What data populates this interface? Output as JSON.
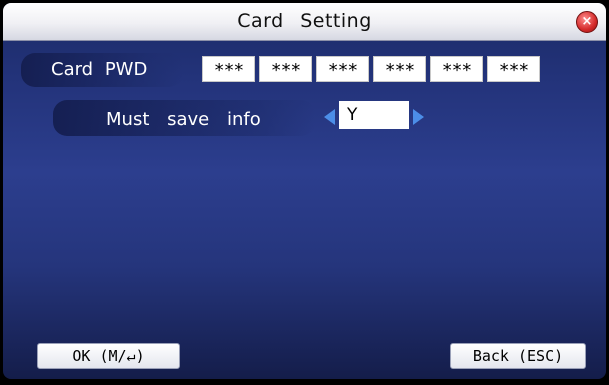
{
  "window": {
    "title": "Card  Setting",
    "close_icon": "close-icon"
  },
  "card_pwd": {
    "label": "Card PWD",
    "fields": [
      "***",
      "***",
      "***",
      "***",
      "***",
      "***"
    ]
  },
  "must_save_info": {
    "label": "Must save  info",
    "value": "Y",
    "left_arrow_icon": "arrow-left-icon",
    "right_arrow_icon": "arrow-right-icon"
  },
  "softkeys": {
    "ok_label": "OK (M/↵)",
    "back_label": "Back (ESC)"
  },
  "colors": {
    "accent_arrow": "#4c8ee8",
    "background_blue": "#2c3e8e",
    "close_red": "#d42a2a"
  }
}
